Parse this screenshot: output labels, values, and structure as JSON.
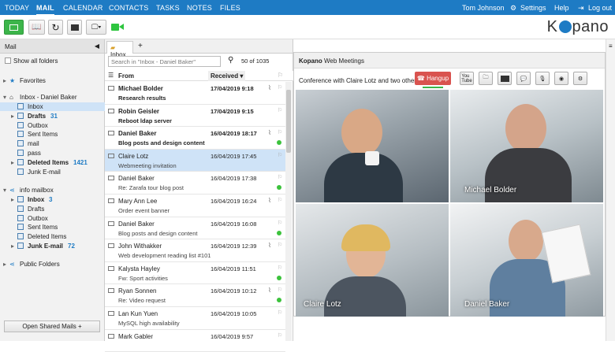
{
  "nav": {
    "tabs": [
      "TODAY",
      "MAIL",
      "CALENDAR",
      "CONTACTS",
      "TASKS",
      "NOTES",
      "FILES"
    ],
    "active": "MAIL",
    "user": "Tom Johnson",
    "settings": "Settings",
    "help": "Help",
    "logout": "Log out"
  },
  "brand": {
    "logo": "Kopano",
    "accent": "#1e7bc4",
    "new_mail_color": "#3cb54a",
    "call_color": "#2ec53f"
  },
  "sidebar": {
    "title": "Mail",
    "show_all": "Show all folders",
    "favorites": "Favorites",
    "store1": "Inbox - Daniel Baker",
    "store1_folders": [
      {
        "label": "Inbox",
        "count": "",
        "bold": false,
        "icon": "inbox-icon"
      },
      {
        "label": "Drafts",
        "count": "31",
        "bold": true,
        "icon": "drafts-icon"
      },
      {
        "label": "Outbox",
        "count": "",
        "bold": false,
        "icon": "outbox-icon"
      },
      {
        "label": "Sent Items",
        "count": "",
        "bold": false,
        "icon": "sent-icon"
      },
      {
        "label": "mail",
        "count": "",
        "bold": false,
        "icon": "folder-icon"
      },
      {
        "label": "pass",
        "count": "",
        "bold": false,
        "icon": "folder-icon"
      },
      {
        "label": "Deleted Items",
        "count": "1421",
        "bold": true,
        "icon": "trash-icon"
      },
      {
        "label": "Junk E-mail",
        "count": "",
        "bold": false,
        "icon": "junk-icon"
      }
    ],
    "store2": "info mailbox",
    "store2_folders": [
      {
        "label": "Inbox",
        "count": "3",
        "bold": true,
        "icon": "inbox-icon"
      },
      {
        "label": "Drafts",
        "count": "",
        "bold": false,
        "icon": "drafts-icon"
      },
      {
        "label": "Outbox",
        "count": "",
        "bold": false,
        "icon": "outbox-icon"
      },
      {
        "label": "Sent Items",
        "count": "",
        "bold": false,
        "icon": "sent-icon"
      },
      {
        "label": "Deleted Items",
        "count": "",
        "bold": false,
        "icon": "trash-icon"
      },
      {
        "label": "Junk E-mail",
        "count": "72",
        "bold": true,
        "icon": "junk-icon"
      }
    ],
    "public": "Public Folders",
    "open_shared": "Open Shared Mails +"
  },
  "maillist": {
    "tab": "Inbox",
    "search_placeholder": "Search in \"Inbox - Daniel Baker\"",
    "count": "50 of 1035",
    "col_from": "From",
    "col_received": "Received",
    "rows": [
      {
        "from": "Michael Bolder",
        "subject": "Research results",
        "date": "17/04/2019 9:18",
        "unread": true,
        "selected": false,
        "attach": true,
        "dot": false
      },
      {
        "from": "Robin Geisler",
        "subject": "Reboot ldap server",
        "date": "17/04/2019 9:15",
        "unread": true,
        "selected": false,
        "attach": false,
        "dot": false
      },
      {
        "from": "Daniel Baker",
        "subject": "Blog posts and design content",
        "date": "16/04/2019 18:17",
        "unread": true,
        "selected": false,
        "attach": true,
        "dot": true
      },
      {
        "from": "Claire Lotz",
        "subject": "Webmeeting invitation",
        "date": "16/04/2019 17:45",
        "unread": false,
        "selected": true,
        "attach": false,
        "dot": false
      },
      {
        "from": "Daniel Baker",
        "subject": "Re: Zarafa tour blog post",
        "date": "16/04/2019 17:38",
        "unread": false,
        "selected": false,
        "attach": false,
        "dot": true
      },
      {
        "from": "Mary Ann Lee",
        "subject": "Order event banner",
        "date": "16/04/2019 16:24",
        "unread": false,
        "selected": false,
        "attach": true,
        "dot": false
      },
      {
        "from": "Daniel Baker",
        "subject": "Blog posts and design content",
        "date": "16/04/2019 16:08",
        "unread": false,
        "selected": false,
        "attach": false,
        "dot": true
      },
      {
        "from": "John Withakker",
        "subject": "Web development reading list #101",
        "date": "16/04/2019 12:39",
        "unread": false,
        "selected": false,
        "attach": true,
        "dot": false
      },
      {
        "from": "Kalysta Hayley",
        "subject": "Fw: Sport activities",
        "date": "16/04/2019 11:51",
        "unread": false,
        "selected": false,
        "attach": false,
        "dot": true
      },
      {
        "from": "Ryan Sonnen",
        "subject": "Re: Video request",
        "date": "16/04/2019 10:12",
        "unread": false,
        "selected": false,
        "attach": true,
        "dot": true
      },
      {
        "from": "Lan Kun Yuen",
        "subject": "MySQL high availability",
        "date": "16/04/2019 10:05",
        "unread": false,
        "selected": false,
        "attach": false,
        "dot": false
      },
      {
        "from": "Mark Gabler",
        "subject": "",
        "date": "16/04/2019 9:57",
        "unread": false,
        "selected": false,
        "attach": false,
        "dot": false
      }
    ]
  },
  "meeting": {
    "title_bold": "Kopano",
    "title_rest": " Web Meetings",
    "conference": "Conference with Claire Lotz and two others",
    "hangup": "Hangup",
    "participants": [
      "Michael Bolder",
      "Claire Lotz",
      "Daniel Baker"
    ]
  }
}
